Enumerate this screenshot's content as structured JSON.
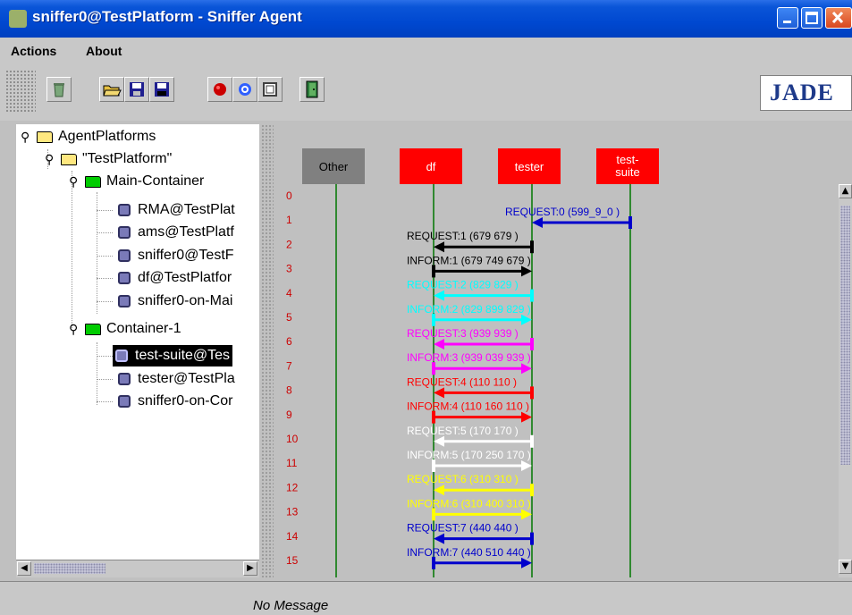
{
  "window": {
    "title": "sniffer0@TestPlatform - Sniffer Agent"
  },
  "menu": [
    {
      "label": "Actions"
    },
    {
      "label": "About"
    }
  ],
  "toolbar": {
    "buttons": [
      {
        "icon": "trash-icon",
        "color": "#6f9a6f"
      },
      {
        "icon": "open-folder-icon",
        "color": "#e6c040"
      },
      {
        "icon": "save-icon",
        "color": "#202090"
      },
      {
        "icon": "floppy-icon",
        "color": "#202090"
      },
      {
        "icon": "record-icon",
        "color": "#cc0000"
      },
      {
        "icon": "target-icon",
        "color": "#3060ff"
      },
      {
        "icon": "display-icon",
        "color": "#404040"
      },
      {
        "icon": "exit-door-icon",
        "color": "#2a7a3a"
      }
    ],
    "logo": "JADE"
  },
  "tree": {
    "root": {
      "label": "AgentPlatforms"
    },
    "platform": {
      "label": "\"TestPlatform\""
    },
    "main_container": {
      "label": "Main-Container",
      "agents": [
        "RMA@TestPlat",
        "ams@TestPlatf",
        "sniffer0@TestF",
        "df@TestPlatfor",
        "sniffer0-on-Mai"
      ]
    },
    "container1": {
      "label": "Container-1",
      "agents": [
        "test-suite@Tes",
        "tester@TestPla",
        "sniffer0-on-Cor"
      ],
      "selected_index": 0
    }
  },
  "sniffer": {
    "agents": [
      {
        "label": "Other",
        "color": "#808080",
        "text_color": "#000000"
      },
      {
        "label": "df",
        "color": "#ff0000",
        "text_color": "#ffffff"
      },
      {
        "label": "tester",
        "color": "#ff0000",
        "text_color": "#ffffff"
      },
      {
        "label": "test-\nsuite",
        "color": "#ff0000",
        "text_color": "#ffffff"
      }
    ],
    "row_numbers": [
      "0",
      "1",
      "2",
      "3",
      "4",
      "5",
      "6",
      "7",
      "8",
      "9",
      "10",
      "11",
      "12",
      "13",
      "14",
      "15"
    ],
    "messages": [
      {
        "row": 0,
        "label": "REQUEST:0 (599_9_0 )",
        "from": 3,
        "to": 2,
        "color": "#0000cc"
      },
      {
        "row": 1,
        "label": "REQUEST:1 (679  679  )",
        "from": 2,
        "to": 1,
        "color": "#000000"
      },
      {
        "row": 2,
        "label": "INFORM:1 (679  749  679 )",
        "from": 1,
        "to": 2,
        "color": "#000000"
      },
      {
        "row": 3,
        "label": "REQUEST:2 (829  829  )",
        "from": 2,
        "to": 1,
        "color": "#00ffff"
      },
      {
        "row": 4,
        "label": "INFORM:2 (829  899  829 )",
        "from": 1,
        "to": 2,
        "color": "#00ffff"
      },
      {
        "row": 5,
        "label": "REQUEST:3 (939  939  )",
        "from": 2,
        "to": 1,
        "color": "#ff00ff"
      },
      {
        "row": 6,
        "label": "INFORM:3 (939  039  939 )",
        "from": 1,
        "to": 2,
        "color": "#ff00ff"
      },
      {
        "row": 7,
        "label": "REQUEST:4 (110  110  )",
        "from": 2,
        "to": 1,
        "color": "#ff0000"
      },
      {
        "row": 8,
        "label": "INFORM:4 (110  160  110 )",
        "from": 1,
        "to": 2,
        "color": "#ff0000"
      },
      {
        "row": 9,
        "label": "REQUEST:5 (170  170  )",
        "from": 2,
        "to": 1,
        "color": "#ffffff"
      },
      {
        "row": 10,
        "label": "INFORM:5 (170  250  170 )",
        "from": 1,
        "to": 2,
        "color": "#ffffff"
      },
      {
        "row": 11,
        "label": "REQUEST:6 (310  310  )",
        "from": 2,
        "to": 1,
        "color": "#ffff00"
      },
      {
        "row": 12,
        "label": "INFORM:6 (310  400  310 )",
        "from": 1,
        "to": 2,
        "color": "#ffff00"
      },
      {
        "row": 13,
        "label": "REQUEST:7 (440  440  )",
        "from": 2,
        "to": 1,
        "color": "#0000cc"
      },
      {
        "row": 14,
        "label": "INFORM:7 (440  510  440 )",
        "from": 1,
        "to": 2,
        "color": "#0000cc"
      }
    ]
  },
  "status": {
    "text": "No Message"
  },
  "colors": {
    "lifeline": "#007700",
    "row_number": "#cc0000"
  }
}
